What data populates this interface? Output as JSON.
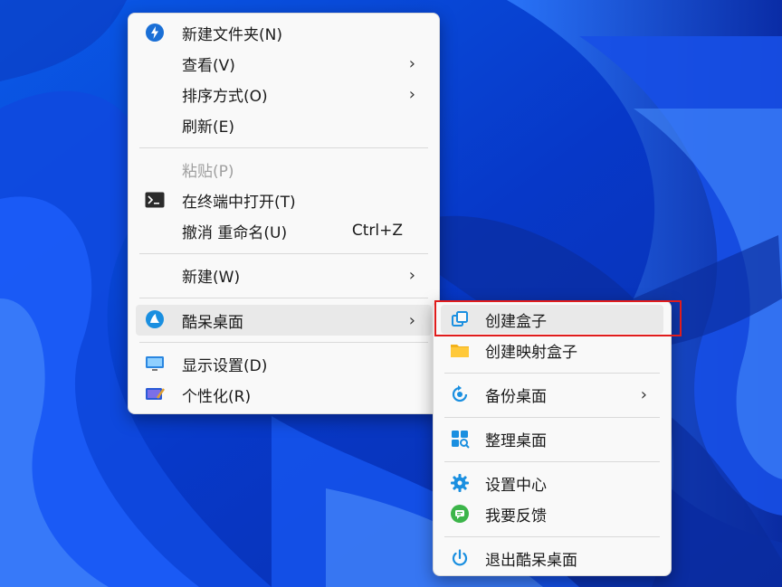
{
  "main_menu": {
    "items": [
      {
        "label": "新建文件夹(N)",
        "icon": "new-folder-icon",
        "has_submenu": false,
        "enabled": true
      },
      {
        "label": "查看(V)",
        "icon": "",
        "has_submenu": true,
        "enabled": true
      },
      {
        "label": "排序方式(O)",
        "icon": "",
        "has_submenu": true,
        "enabled": true
      },
      {
        "label": "刷新(E)",
        "icon": "",
        "has_submenu": false,
        "enabled": true
      },
      {
        "label": "粘贴(P)",
        "icon": "",
        "has_submenu": false,
        "enabled": false
      },
      {
        "label": "在终端中打开(T)",
        "icon": "terminal-icon",
        "has_submenu": false,
        "enabled": true
      },
      {
        "label": "撤消 重命名(U)",
        "accelerator": "Ctrl+Z",
        "icon": "",
        "has_submenu": false,
        "enabled": true
      },
      {
        "label": "新建(W)",
        "icon": "",
        "has_submenu": true,
        "enabled": true
      },
      {
        "label": "酷呆桌面",
        "icon": "kudai-logo-icon",
        "has_submenu": true,
        "enabled": true,
        "highlighted": true
      },
      {
        "label": "显示设置(D)",
        "icon": "display-settings-icon",
        "has_submenu": false,
        "enabled": true
      },
      {
        "label": "个性化(R)",
        "icon": "personalize-icon",
        "has_submenu": false,
        "enabled": true
      }
    ]
  },
  "sub_menu": {
    "items": [
      {
        "label": "创建盒子",
        "icon": "create-box-icon",
        "highlighted": true
      },
      {
        "label": "创建映射盒子",
        "icon": "folder-icon"
      },
      {
        "label": "备份桌面",
        "icon": "backup-icon",
        "has_submenu": true
      },
      {
        "label": "整理桌面",
        "icon": "organize-icon"
      },
      {
        "label": "设置中心",
        "icon": "gear-icon"
      },
      {
        "label": "我要反馈",
        "icon": "feedback-icon"
      },
      {
        "label": "退出酷呆桌面",
        "icon": "power-icon"
      }
    ]
  },
  "arrow_glyph": "›",
  "colors": {
    "accent_blue": "#1a8fe0",
    "highlight_border": "#e01c1c",
    "menu_bg": "#f9f9f9"
  }
}
